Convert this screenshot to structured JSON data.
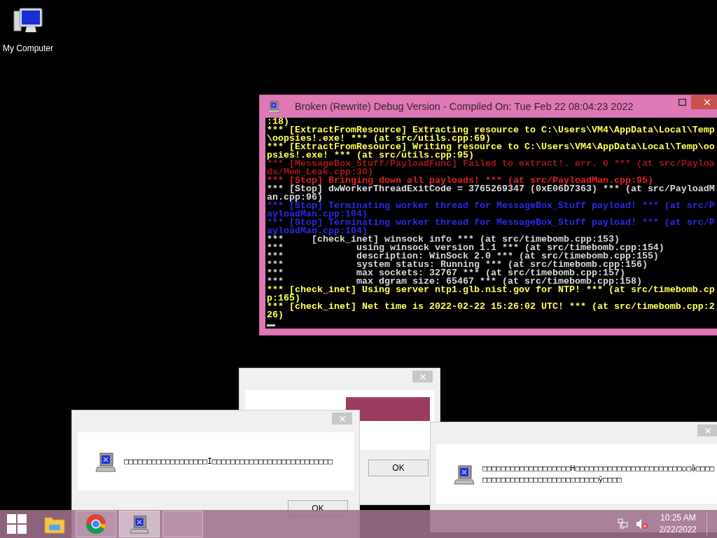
{
  "desktop_icons": [
    {
      "label": "My Computer"
    }
  ],
  "console": {
    "title": "Broken (Rewrite) Debug Version - Compiled On: Tue Feb 22 08:04:23 2022",
    "lines": [
      {
        "kind": "info",
        "text": ":18)"
      },
      {
        "kind": "info",
        "text": "*** [ExtractFromResource] Extracting resource to C:\\Users\\VM4\\AppData\\Local\\Temp"
      },
      {
        "kind": "info",
        "text": "\\oopsies!.exe! *** (at src/utils.cpp:69)"
      },
      {
        "kind": "info",
        "text": "*** [ExtractFromResource] Writing resource to C:\\Users\\VM4\\AppData\\Local\\Temp\\oo"
      },
      {
        "kind": "info",
        "text": "psies!.exe! *** (at src/utils.cpp:95)"
      },
      {
        "kind": "error_dim",
        "text": "*** [MessageBox_Stuff/PayloadFunc] Failed to extract!. err. 0 *** (at src/Payloa"
      },
      {
        "kind": "error_dim",
        "text": "ds/Mem_Leak.cpp:30)"
      },
      {
        "kind": "error",
        "text": "*** [Stop] Bringing down all payloads! *** (at src/PayloadMan.cpp:95)"
      },
      {
        "kind": "plain",
        "text": "*** [Stop] dwWorkerThreadExitCode = 3765269347 (0xE06D7363) *** (at src/PayloadM"
      },
      {
        "kind": "plain",
        "text": "an.cpp:96)"
      },
      {
        "kind": "notice",
        "text": "*** [Stop] Terminating worker thread for MessageBox_Stuff payload! *** (at src/P"
      },
      {
        "kind": "notice",
        "text": "ayloadMan.cpp:104)"
      },
      {
        "kind": "notice",
        "text": "*** [Stop] Terminating worker thread for MessageBox_Stuff payload! *** (at src/P"
      },
      {
        "kind": "notice",
        "text": "ayloadMan.cpp:104)"
      },
      {
        "kind": "plain",
        "text": "***     [check_inet] winsock info *** (at src/timebomb.cpp:153)"
      },
      {
        "kind": "plain",
        "text": "***             using winsock version 1.1 *** (at src/timebomb.cpp:154)"
      },
      {
        "kind": "plain",
        "text": "***             description: WinSock 2.0 *** (at src/timebomb.cpp:155)"
      },
      {
        "kind": "plain",
        "text": "***             system status: Running *** (at src/timebomb.cpp:156)"
      },
      {
        "kind": "plain",
        "text": "***             max sockets: 32767 *** (at src/timebomb.cpp:157)"
      },
      {
        "kind": "plain",
        "text": "***             max dgram size: 65467 *** (at src/timebomb.cpp:158)"
      },
      {
        "kind": "info",
        "text": "*** [check_inet] Using server ntp1.glb.nist.gov for NTP! *** (at src/timebomb.cp"
      },
      {
        "kind": "info",
        "text": "p:165)"
      },
      {
        "kind": "info",
        "text": "*** [check_inet] Net time is 2022-02-22 15:26:02 UTC! *** (at src/timebomb.cpp:2"
      },
      {
        "kind": "info",
        "text": "26)"
      }
    ]
  },
  "dialogs": [
    {
      "button": "OK"
    },
    {
      "message_lines": [
        "□□□□□□□□□□□□□□□□□□Ì□□□□□□□□□□□□□□□□□□□□□□□□□□"
      ],
      "button": "OK"
    },
    {
      "message_lines": [
        "□□□□□□□□□□□□□□□□□□□H□□□□□□□□□□□□□□□□□□□□□□□○□ậ□□□□",
        "□□□□□□□□□□□□□□□□□□□□□□□□□ӯ□□□□"
      ]
    }
  ],
  "taskbar": {
    "buttons": [
      {
        "kind": "explorer",
        "selected": false
      },
      {
        "kind": "browser",
        "selected": false
      },
      {
        "kind": "app",
        "selected": true
      },
      {
        "kind": "blank",
        "selected": false
      }
    ],
    "clock": {
      "time": "10:25 AM",
      "date": "2/22/2022"
    }
  }
}
